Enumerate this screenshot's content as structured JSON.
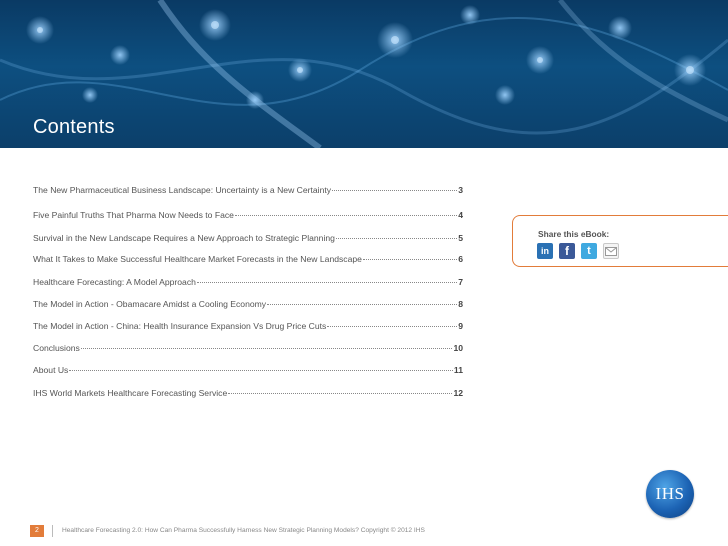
{
  "banner": {
    "title": "Contents"
  },
  "toc": [
    {
      "title": "The New Pharmaceutical Business Landscape: Uncertainty is a New Certainty",
      "page": "3"
    },
    {
      "title": "Five Painful Truths That Pharma Now Needs to Face",
      "page": "4"
    },
    {
      "title": "Survival in the New Landscape Requires a New Approach to Strategic Planning",
      "page": "5"
    },
    {
      "title": "What It Takes to Make Successful Healthcare Market Forecasts in the New Landscape",
      "page": "6"
    },
    {
      "title": "Healthcare Forecasting: A Model Approach",
      "page": "7"
    },
    {
      "title": "The Model in Action - Obamacare Amidst a Cooling Economy",
      "page": "8"
    },
    {
      "title": "The Model in Action - China: Health Insurance Expansion Vs Drug Price Cuts",
      "page": "9"
    },
    {
      "title": "Conclusions",
      "page": "10"
    },
    {
      "title": "About Us",
      "page": "11"
    },
    {
      "title": "IHS World Markets Healthcare Forecasting Service",
      "page": "12"
    }
  ],
  "share": {
    "label": "Share this eBook:",
    "icons": [
      {
        "name": "linkedin-icon",
        "glyph": "in"
      },
      {
        "name": "facebook-icon",
        "glyph": "f"
      },
      {
        "name": "twitter-icon",
        "glyph": "t"
      },
      {
        "name": "email-icon",
        "glyph": "✉"
      }
    ]
  },
  "logo": {
    "text": "IHS"
  },
  "footer": {
    "page_number": "2",
    "text": "Healthcare Forecasting 2.0: How Can Pharma Successfully Harness New Strategic Planning Models? Copyright © 2012 IHS"
  },
  "colors": {
    "accent": "#e27c3a",
    "banner": "#0d4f80",
    "logo": "#1c63b4"
  }
}
